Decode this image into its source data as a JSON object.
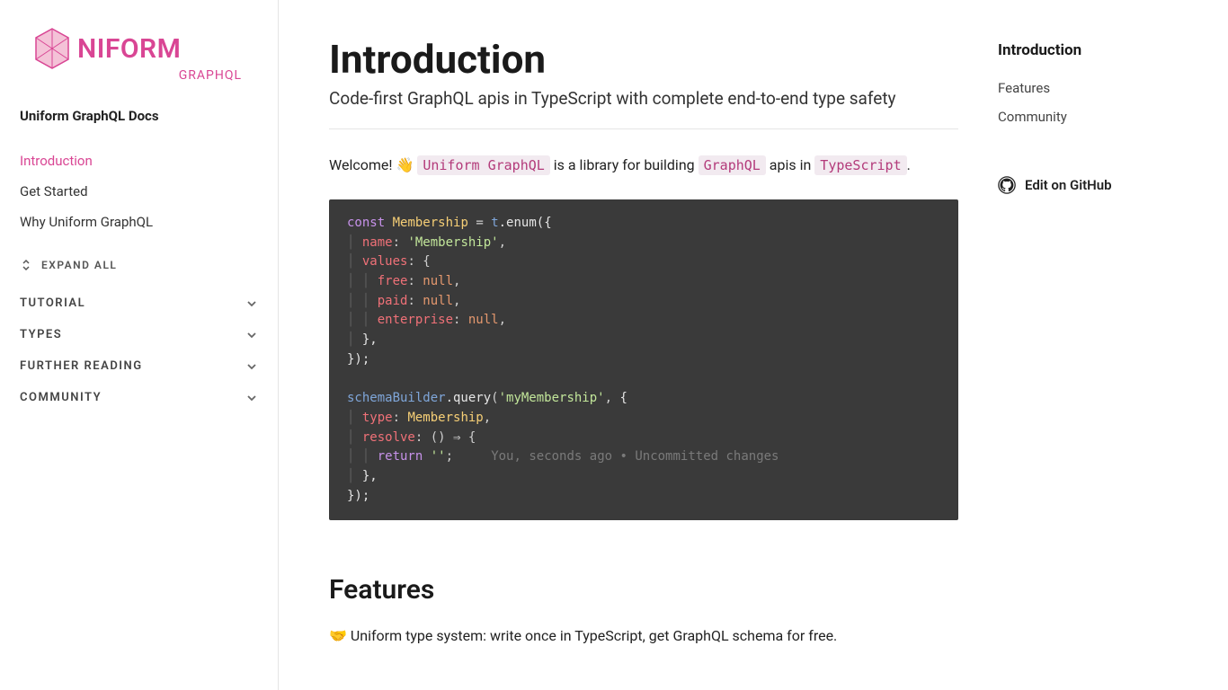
{
  "sidebar": {
    "logo_main": "NIFORM",
    "logo_sub": "GRAPHQL",
    "docs_title": "Uniform GraphQL Docs",
    "nav": [
      {
        "label": "Introduction",
        "active": true
      },
      {
        "label": "Get Started",
        "active": false
      },
      {
        "label": "Why Uniform GraphQL",
        "active": false
      }
    ],
    "expand_all_label": "EXPAND ALL",
    "sections": [
      "TUTORIAL",
      "TYPES",
      "FURTHER READING",
      "COMMUNITY"
    ]
  },
  "page": {
    "title": "Introduction",
    "subtitle": "Code-first GraphQL apis in TypeScript with complete end-to-end type safety",
    "intro": {
      "pre": "Welcome! ",
      "emoji": "👋",
      "code1": "Uniform GraphQL",
      "mid": " is a library for building ",
      "code2": "GraphQL",
      "after": " apis in ",
      "code3": "TypeScript",
      "end": "."
    },
    "features_title": "Features",
    "feature_line_emoji": "🤝",
    "feature_line_text": "Uniform type system: write once in TypeScript, get GraphQL schema for free."
  },
  "code": {
    "l1_keyword": "const",
    "l1_type": "Membership",
    "l1_eq": " = ",
    "l1_t": "t",
    "l1_dot_enum": ".enum",
    "l1_paren_brace": "({",
    "l2_name": "name",
    "l2_colon": ": ",
    "l2_str": "'Membership'",
    "l2_comma": ",",
    "l3_values": "values",
    "l3_colon_brace": ": {",
    "l4_free": "free",
    "l4_colon": ": ",
    "l4_null": "null",
    "l4_comma": ",",
    "l5_paid": "paid",
    "l5_colon": ": ",
    "l5_null": "null",
    "l5_comma": ",",
    "l6_ent": "enterprise",
    "l6_colon": ": ",
    "l6_null": "null",
    "l6_comma": ",",
    "l7_close": "},",
    "l8_close_paren": "});",
    "l9_sb": "schemaBuilder",
    "l9_dot_query": ".query",
    "l9_open": "(",
    "l9_str": "'myMembership'",
    "l9_comma": ", ",
    "l9_brace": "{",
    "l10_type": "type",
    "l10_colon": ": ",
    "l10_membership": "Membership",
    "l10_comma": ",",
    "l11_resolve": "resolve",
    "l11_rest": ": () ⇒ {",
    "l12_return": "return",
    "l12_str": "''",
    "l12_semi": ";",
    "l12_comment": "You, seconds ago • Uncommitted changes",
    "l13_close": "},",
    "l14_close": "});"
  },
  "toc": {
    "title": "Introduction",
    "items": [
      "Features",
      "Community"
    ],
    "edit_label": "Edit on GitHub"
  }
}
